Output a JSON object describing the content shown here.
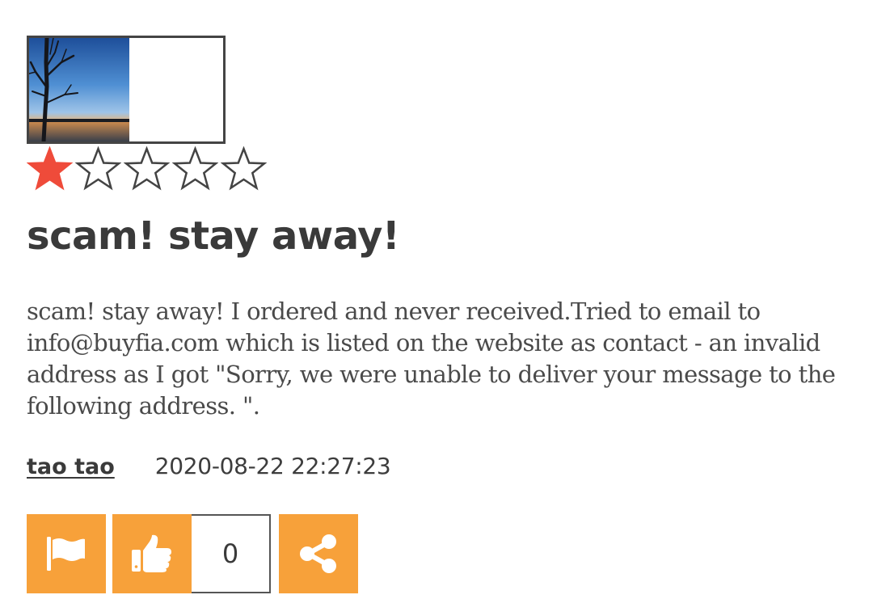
{
  "review": {
    "photo_icon": "landscape-photo",
    "rating": 1,
    "rating_max": 5,
    "colors": {
      "star_filled": "#ef4b3a",
      "star_empty": "#444444",
      "action_button": "#f7a13a"
    },
    "title": "scam! stay away!",
    "body": "scam! stay away! I ordered and never received.Tried to email to info@buyfia.com which is listed on the website as contact - an invalid address as I got \"Sorry, we were unable to deliver your message to the following address. \".",
    "author": "tao tao",
    "date": "2020-08-22 22:27:23",
    "actions": {
      "flag_icon": "flag-icon",
      "like_icon": "thumbs-up-icon",
      "like_count": "0",
      "share_icon": "share-icon"
    }
  }
}
